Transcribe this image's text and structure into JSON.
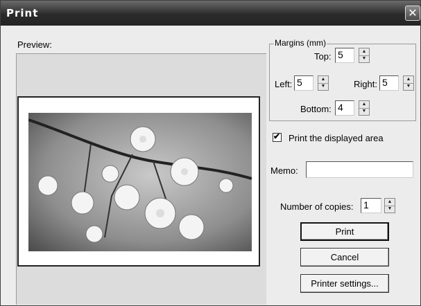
{
  "window": {
    "title": "Print",
    "close_glyph": "✕"
  },
  "preview": {
    "label": "Preview:"
  },
  "margins": {
    "group_title": "Margins (mm)",
    "top": {
      "label": "Top:",
      "value": "5"
    },
    "left": {
      "label": "Left:",
      "value": "5"
    },
    "right": {
      "label": "Right:",
      "value": "5"
    },
    "bottom": {
      "label": "Bottom:",
      "value": "4"
    }
  },
  "print_displayed_area": {
    "label": "Print the displayed area",
    "checked": true,
    "check_glyph": "✔"
  },
  "memo": {
    "label": "Memo:",
    "value": ""
  },
  "copies": {
    "label": "Number of copies:",
    "value": "1"
  },
  "buttons": {
    "print": "Print",
    "cancel": "Cancel",
    "printer_settings": "Printer settings..."
  },
  "spinner": {
    "up_glyph": "▲",
    "down_glyph": "▼"
  },
  "icons": {
    "close": "close-icon",
    "checkmark": "checkmark-icon",
    "spin_up": "spin-up-icon",
    "spin_down": "spin-down-icon"
  }
}
